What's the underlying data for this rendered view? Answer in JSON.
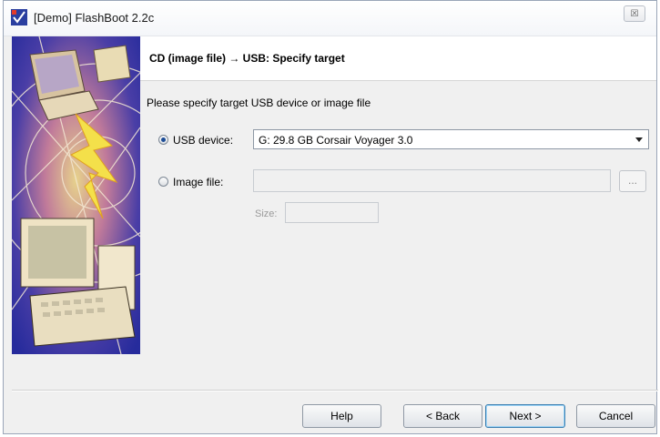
{
  "window": {
    "title": "[Demo] FlashBoot 2.2c",
    "close_glyph": "☒"
  },
  "header": {
    "title": "CD (image file) → USB: Specify target"
  },
  "main": {
    "instruction": "Please specify target USB device or image file",
    "usb_option": {
      "label": "USB device:",
      "selected": true
    },
    "usb_device_value": "G:   29.8 GB    Corsair Voyager 3.0",
    "image_option": {
      "label": "Image file:",
      "selected": false
    },
    "image_file_value": "",
    "browse_label": "...",
    "size_label": "Size:",
    "size_value": ""
  },
  "buttons": {
    "help": "Help",
    "back": "< Back",
    "next": "Next >",
    "cancel": "Cancel"
  },
  "colors": {
    "side_panel_bg": "#2a2fa8",
    "accent": "#1d4d96"
  },
  "icons": {
    "app_icon": "flashboot-app-icon",
    "close": "close-icon",
    "dropdown": "chevron-down-icon"
  }
}
